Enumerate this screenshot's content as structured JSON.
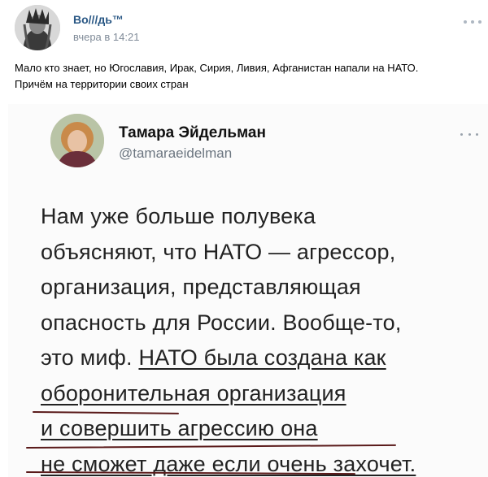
{
  "post": {
    "author": "Во///дь™",
    "time": "вчера в 14:21",
    "text_lines": [
      "Мало кто знает, но Югославия, Ирак, Сирия, Ливия, Афганистан напали на НАТО.",
      "Причём на территории своих стран"
    ],
    "menu_icon": "more-horizontal-icon"
  },
  "tweet": {
    "name": "Тамара Эйдельман",
    "handle": "@tamaraeidelman",
    "menu_icon": "more-horizontal-icon",
    "lines": [
      {
        "pre": "Нам уже больше полувека",
        "u": "",
        "post": ""
      },
      {
        "pre": "объясняют, что НАТО — агрессор,",
        "u": "",
        "post": ""
      },
      {
        "pre": "организация, представляющая",
        "u": "",
        "post": ""
      },
      {
        "pre": "опасность для России. Вообще-то,",
        "u": "",
        "post": ""
      },
      {
        "pre": "это миф. ",
        "u": "НАТО была создана как",
        "post": ""
      },
      {
        "pre": "",
        "u": "оборонительная организация",
        "post": ""
      },
      {
        "pre": "",
        "u": "и совершить агрессию она",
        "post": ""
      },
      {
        "pre": "",
        "u": "не сможет даже если очень захочет.",
        "post": ""
      }
    ]
  },
  "colors": {
    "author_link": "#2a5885",
    "meta_gray": "#818c99",
    "handle_gray": "#6c7680",
    "pen_underline": "#5a1a1a"
  }
}
